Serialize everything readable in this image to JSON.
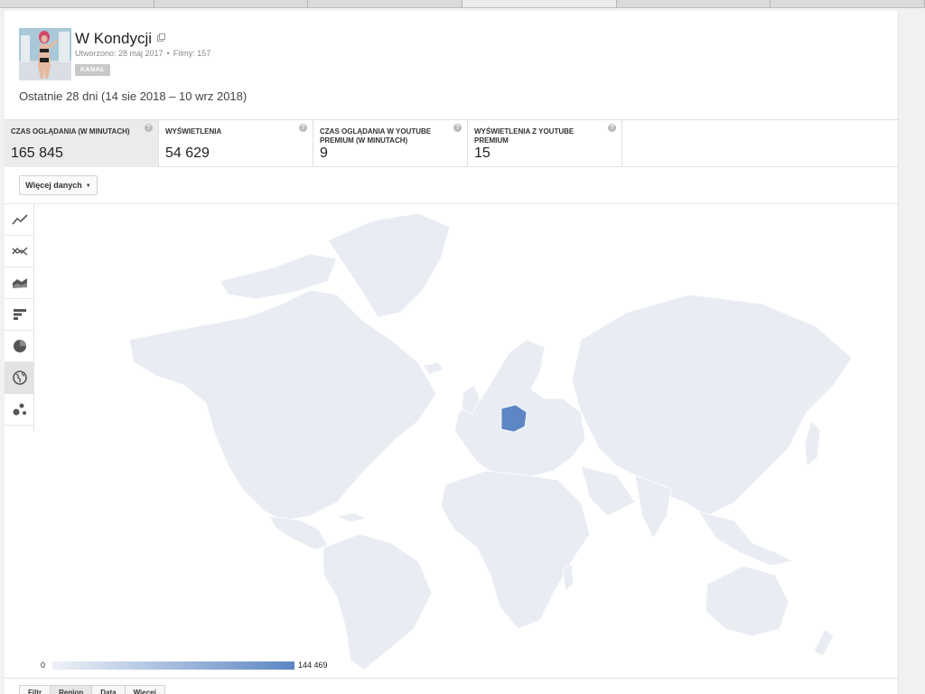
{
  "channel": {
    "name": "W Kondycji",
    "created": "Utworzono: 28 maj 2017",
    "videos": "Filmy: 157",
    "badge": "KANAŁ"
  },
  "period": "Ostatnie 28 dni (14 sie 2018 – 10 wrz 2018)",
  "metrics": [
    {
      "label": "CZAS OGLĄDANIA (W MINUTACH)",
      "value": "165 845",
      "selected": true
    },
    {
      "label": "WYŚWIETLENIA",
      "value": "54 629"
    },
    {
      "label": "CZAS OGLĄDANIA W YOUTUBE PREMIUM (W MINUTACH)",
      "value": "9"
    },
    {
      "label": "WYŚWIETLENIA Z YOUTUBE PREMIUM",
      "value": "15"
    }
  ],
  "more_data_label": "Więcej danych",
  "chart_types": [
    "line-chart-icon",
    "multi-line-icon",
    "area-chart-icon",
    "bar-chart-icon",
    "pie-chart-icon",
    "globe-icon",
    "bubble-chart-icon"
  ],
  "selected_chart_type": "globe-icon",
  "chart_data": {
    "type": "map",
    "metric": "CZAS OGLĄDANIA (W MINUTACH)",
    "regions": [
      {
        "name": "Poland",
        "value": 144469
      }
    ],
    "scale_min": "0",
    "scale_max": "144 469",
    "colors": {
      "low": "#eef1f7",
      "high": "#5c86c4",
      "land": "#e9edf3",
      "border": "#ffffff"
    }
  },
  "bottom_tabs": [
    "Filtr",
    "Region",
    "Data",
    "Więcej"
  ]
}
